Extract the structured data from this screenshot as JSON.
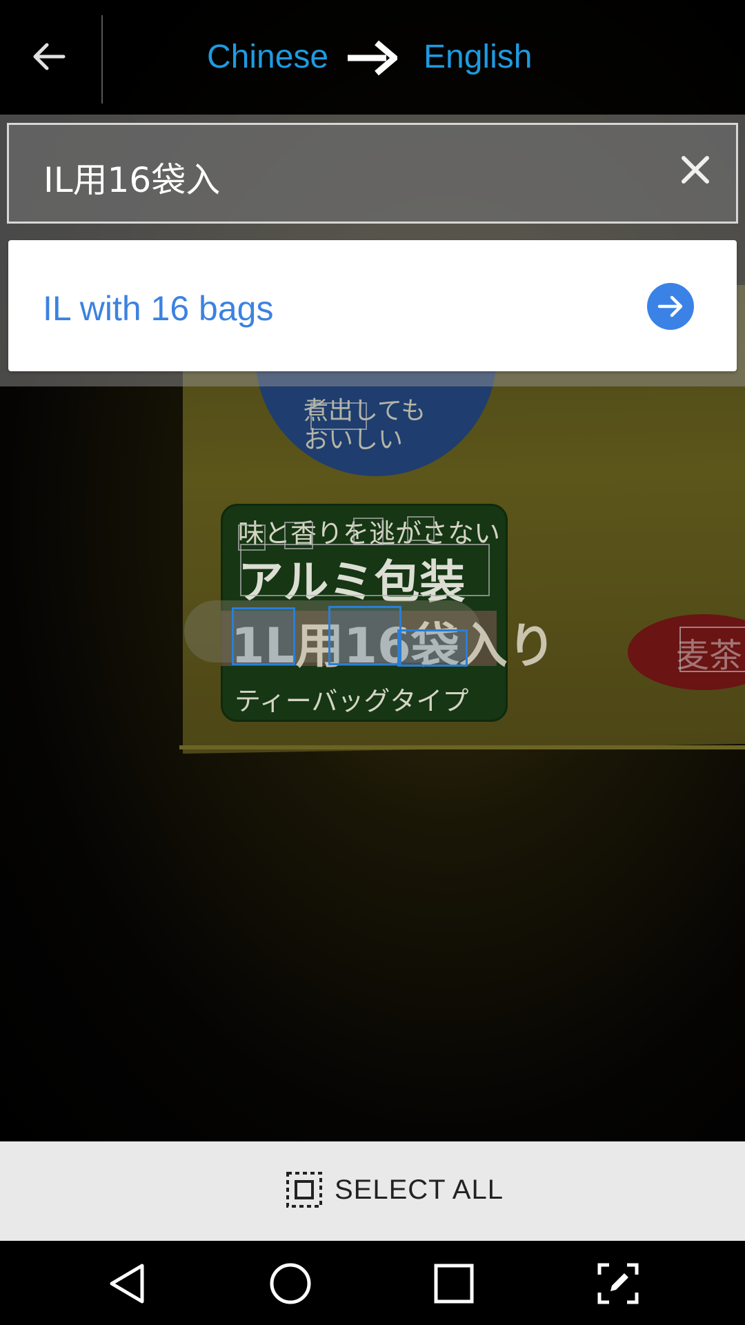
{
  "header": {
    "source_language": "Chinese",
    "target_language": "English"
  },
  "input": {
    "text": "IL用16袋入"
  },
  "result": {
    "translation": "IL with 16 bags"
  },
  "camera_text": {
    "line_small": "煮出しても おいしい",
    "line1": "味と香りを逃がさない",
    "line2": "アルミ包装",
    "line3": "1L用16袋入り",
    "line4": "ティーバッグタイプ",
    "side_word": "麦茶"
  },
  "select_all": {
    "label": "SELECT ALL"
  },
  "colors": {
    "accent_blue": "#1e9be0",
    "result_blue": "#3c82e0",
    "go_button": "#3b82e6"
  },
  "icons": {
    "back": "arrow-left-icon",
    "swap": "arrow-right-icon",
    "clear": "close-icon",
    "go": "arrow-circle-right-icon",
    "select_all": "select-all-icon",
    "nav_back": "triangle-back-icon",
    "nav_home": "circle-home-icon",
    "nav_recents": "square-recents-icon",
    "nav_edit": "screenshot-edit-icon"
  }
}
